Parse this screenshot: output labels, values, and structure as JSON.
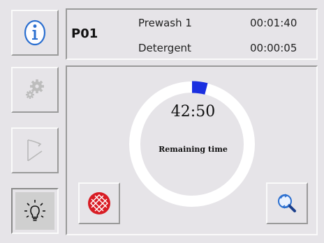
{
  "program": {
    "code": "P01"
  },
  "steps": [
    {
      "name": "Prewash 1",
      "time": "00:01:40"
    },
    {
      "name": "Detergent",
      "time": "00:00:05"
    }
  ],
  "timer": {
    "value": "42:50",
    "label": "Remaining time",
    "progress_fraction": 0.04
  },
  "icons": {
    "info": "info-icon",
    "settings": "gears-icon",
    "dosing": "dosing-icon",
    "light": "light-bulb-icon",
    "stop": "stop-icon",
    "search": "search-refresh-icon"
  },
  "colors": {
    "accent_blue": "#1a2fe0",
    "ring": "#ffffff",
    "stop_red": "#d81c24",
    "info_blue": "#2b6fd0"
  }
}
